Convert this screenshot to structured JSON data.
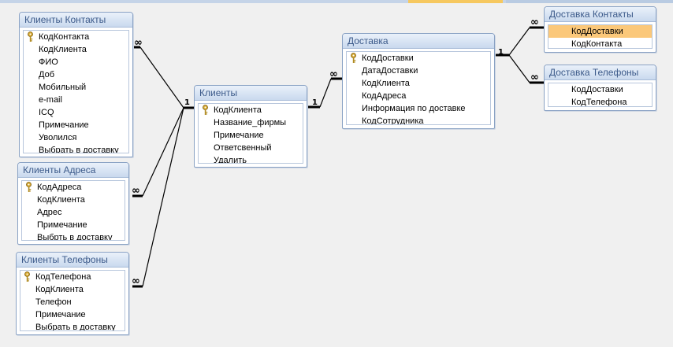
{
  "tables": {
    "klienty_kontakty": {
      "title": "Клиенты Контакты",
      "fields": [
        "КодКонтакта",
        "КодКлиента",
        "ФИО",
        "Доб",
        "Мобильный",
        "e-mail",
        "ICQ",
        "Примечание",
        "Уволился",
        "Выбрать в доставку"
      ]
    },
    "klienty_adresa": {
      "title": "Клиенты Адреса",
      "fields": [
        "КодАдреса",
        "КодКлиента",
        "Адрес",
        "Примечание",
        "Выбрть в доставку"
      ]
    },
    "klienty_telefony": {
      "title": "Клиенты Телефоны",
      "fields": [
        "КодТелефона",
        "КодКлиента",
        "Телефон",
        "Примечание",
        "Выбрать в доставку"
      ]
    },
    "klienty": {
      "title": "Клиенты",
      "fields": [
        "КодКлиента",
        "Название_фирмы",
        "Примечание",
        "Ответсвенный",
        "Удалить"
      ]
    },
    "dostavka": {
      "title": "Доставка",
      "fields": [
        "КодДоставки",
        "ДатаДоставки",
        "КодКлиента",
        "КодАдреса",
        "Информация по доставке",
        "КодСотрудника"
      ]
    },
    "dostavka_kontakty": {
      "title": "Доставка Контакты",
      "fields": [
        "КодДоставки",
        "КодКонтакта"
      ]
    },
    "dostavka_telefony": {
      "title": "Доставка Телефоны",
      "fields": [
        "КодДоставки",
        "КодТелефона"
      ]
    }
  },
  "relationships": {
    "one_label": "1",
    "many_label": "∞"
  },
  "icons": {
    "primary_key": "key-icon"
  },
  "colors": {
    "selected_field": "#fbc87a",
    "table_header_text": "#3c5a8a",
    "relationship_line": "#000000"
  }
}
